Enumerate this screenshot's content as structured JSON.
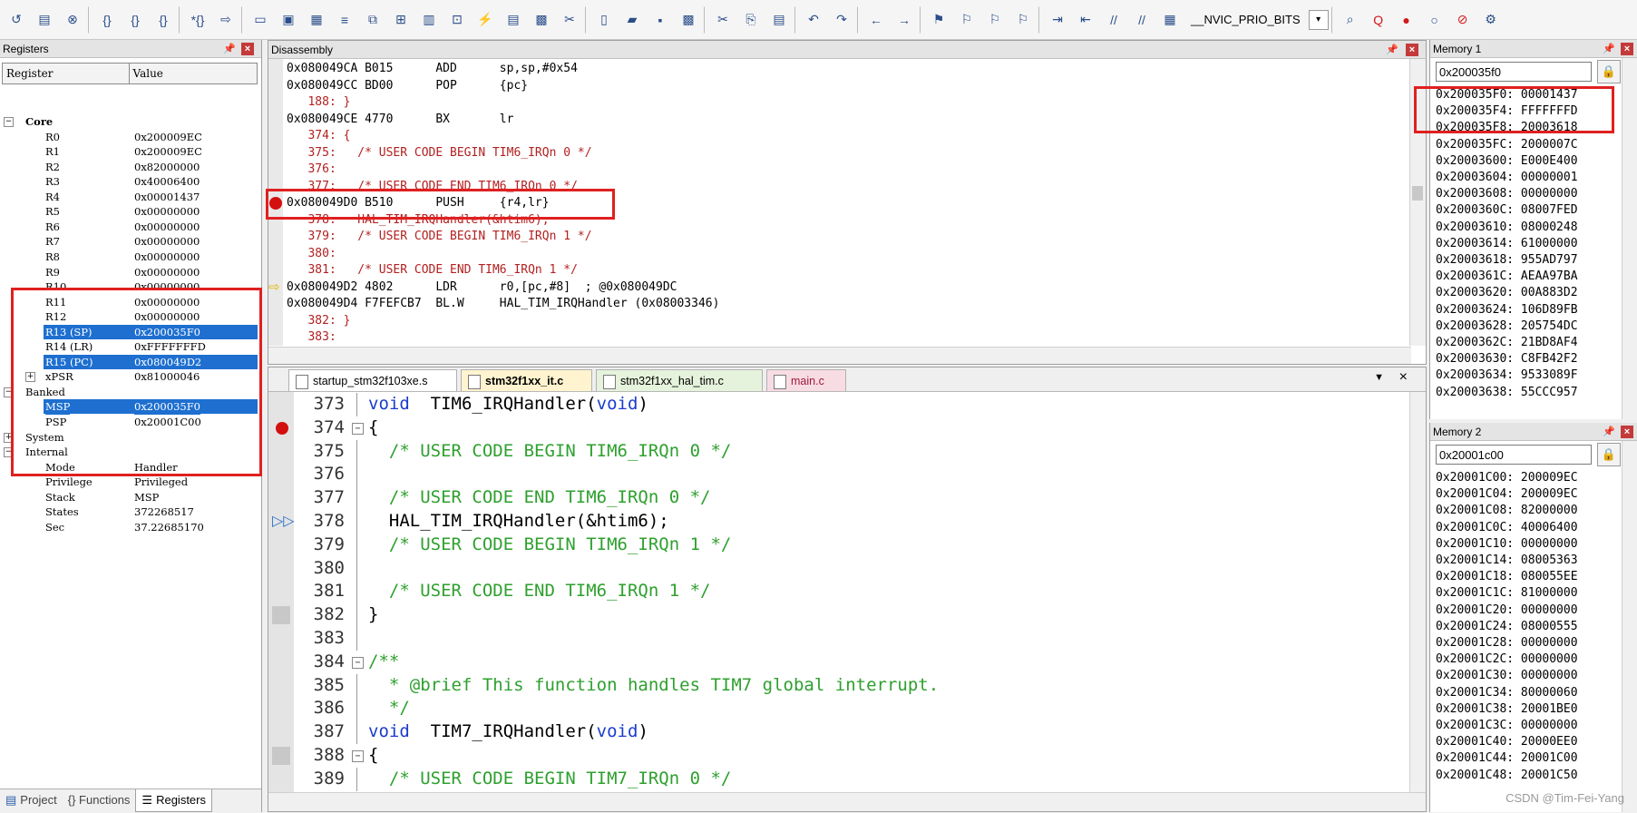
{
  "toolbar": {
    "combo_text": "__NVIC_PRIO_BITS",
    "icons": [
      "reset-icon",
      "run-icon",
      "stop-icon",
      "step-into-icon",
      "step-over-icon",
      "step-out-icon",
      "run-to-cursor-icon",
      "show-next-statement-icon",
      "command-window-icon",
      "disassembly-window-icon",
      "symbols-window-icon",
      "registers-window-icon",
      "call-stack-icon",
      "watch-window-icon",
      "memory-window-icon",
      "serial-window-icon",
      "analysis-window-icon",
      "trace-window-icon",
      "system-viewer-icon",
      "toolbox-icon",
      "new-file-icon",
      "open-file-icon",
      "save-icon",
      "save-all-icon",
      "cut-icon",
      "copy-icon",
      "paste-icon",
      "undo-icon",
      "redo-icon",
      "nav-back-icon",
      "nav-forward-icon",
      "bookmark-icon",
      "bookmark-prev-icon",
      "bookmark-next-icon",
      "bookmark-clear-icon",
      "indent-icon",
      "unindent-icon",
      "comment-icon",
      "uncomment-icon",
      "find-in-files-icon",
      "find-icon",
      "debug-session-icon",
      "insert-breakpoint-icon",
      "enable-breakpoint-icon",
      "kill-breakpoints-icon",
      "options-icon"
    ]
  },
  "registers": {
    "title": "Registers",
    "col_register": "Register",
    "col_value": "Value",
    "rows": [
      {
        "name": "Core",
        "value": "",
        "bold": true
      },
      {
        "name": "R0",
        "value": "0x200009EC"
      },
      {
        "name": "R1",
        "value": "0x200009EC"
      },
      {
        "name": "R2",
        "value": "0x82000000"
      },
      {
        "name": "R3",
        "value": "0x40006400"
      },
      {
        "name": "R4",
        "value": "0x00001437"
      },
      {
        "name": "R5",
        "value": "0x00000000"
      },
      {
        "name": "R6",
        "value": "0x00000000"
      },
      {
        "name": "R7",
        "value": "0x00000000"
      },
      {
        "name": "R8",
        "value": "0x00000000"
      },
      {
        "name": "R9",
        "value": "0x00000000"
      },
      {
        "name": "R10",
        "value": "0x00000000"
      },
      {
        "name": "R11",
        "value": "0x00000000"
      },
      {
        "name": "R12",
        "value": "0x00000000"
      },
      {
        "name": "R13 (SP)",
        "value": "0x200035F0",
        "selected": true
      },
      {
        "name": "R14 (LR)",
        "value": "0xFFFFFFFD"
      },
      {
        "name": "R15 (PC)",
        "value": "0x080049D2",
        "selected": true
      },
      {
        "name": "xPSR",
        "value": "0x81000046"
      },
      {
        "name": "Banked",
        "value": ""
      },
      {
        "name": "MSP",
        "value": "0x200035F0",
        "selected": true
      },
      {
        "name": "PSP",
        "value": "0x20001C00"
      },
      {
        "name": "System",
        "value": ""
      },
      {
        "name": "Internal",
        "value": ""
      },
      {
        "name": "Mode",
        "value": "Handler"
      },
      {
        "name": "Privilege",
        "value": "Privileged"
      },
      {
        "name": "Stack",
        "value": "MSP"
      },
      {
        "name": "States",
        "value": "372268517"
      },
      {
        "name": "Sec",
        "value": "37.22685170"
      }
    ],
    "tabs": [
      "Project",
      "{} Functions",
      "Registers"
    ]
  },
  "disassembly": {
    "title": "Disassembly",
    "lines": [
      {
        "text": "0x080049CA B015      ADD      sp,sp,#0x54",
        "type": "asm"
      },
      {
        "text": "0x080049CC BD00      POP      {pc}",
        "type": "asm"
      },
      {
        "text": "   188: }",
        "type": "src"
      },
      {
        "text": "0x080049CE 4770      BX       lr",
        "type": "asm"
      },
      {
        "text": "   374: {",
        "type": "src"
      },
      {
        "text": "   375:   /* USER CODE BEGIN TIM6_IRQn 0 */",
        "type": "src"
      },
      {
        "text": "   376:",
        "type": "src"
      },
      {
        "text": "   377:   /* USER CODE END TIM6_IRQn 0 */",
        "type": "src"
      },
      {
        "text": "0x080049D0 B510      PUSH     {r4,lr}",
        "type": "asm"
      },
      {
        "text": "   378:   HAL_TIM_IRQHandler(&htim6);",
        "type": "src"
      },
      {
        "text": "   379:   /* USER CODE BEGIN TIM6_IRQn 1 */",
        "type": "src"
      },
      {
        "text": "   380:",
        "type": "src"
      },
      {
        "text": "   381:   /* USER CODE END TIM6_IRQn 1 */",
        "type": "src"
      },
      {
        "text": "0x080049D2 4802      LDR      r0,[pc,#8]  ; @0x080049DC",
        "type": "asm"
      },
      {
        "text": "0x080049D4 F7FEFCB7  BL.W     HAL_TIM_IRQHandler (0x08003346)",
        "type": "asm"
      },
      {
        "text": "   382: }",
        "type": "src"
      },
      {
        "text": "   383:",
        "type": "src"
      }
    ]
  },
  "editor": {
    "tabs": [
      {
        "label": "startup_stm32f103xe.s",
        "active": false
      },
      {
        "label": "stm32f1xx_it.c",
        "active": true
      },
      {
        "label": "stm32f1xx_hal_tim.c",
        "active": false
      },
      {
        "label": "main.c",
        "active": false
      }
    ],
    "lines": [
      {
        "num": "373",
        "fold": "",
        "parts": [
          [
            "kw",
            "void"
          ],
          [
            "",
            "  TIM6_IRQHandler("
          ],
          [
            "kw",
            "void"
          ],
          [
            "",
            ")"
          ]
        ]
      },
      {
        "num": "374",
        "fold": "-",
        "parts": [
          [
            "",
            "{"
          ]
        ]
      },
      {
        "num": "375",
        "fold": "",
        "parts": [
          [
            "cmt",
            "  /* USER CODE BEGIN TIM6_IRQn 0 */"
          ]
        ]
      },
      {
        "num": "376",
        "fold": "",
        "parts": [
          [
            "",
            ""
          ]
        ]
      },
      {
        "num": "377",
        "fold": "",
        "parts": [
          [
            "cmt",
            "  /* USER CODE END TIM6_IRQn 0 */"
          ]
        ]
      },
      {
        "num": "378",
        "fold": "",
        "parts": [
          [
            "",
            "  HAL_TIM_IRQHandler(&htim6);"
          ]
        ]
      },
      {
        "num": "379",
        "fold": "",
        "parts": [
          [
            "cmt",
            "  /* USER CODE BEGIN TIM6_IRQn 1 */"
          ]
        ]
      },
      {
        "num": "380",
        "fold": "",
        "parts": [
          [
            "",
            ""
          ]
        ]
      },
      {
        "num": "381",
        "fold": "",
        "parts": [
          [
            "cmt",
            "  /* USER CODE END TIM6_IRQn 1 */"
          ]
        ]
      },
      {
        "num": "382",
        "fold": "",
        "parts": [
          [
            "",
            "}"
          ]
        ]
      },
      {
        "num": "383",
        "fold": "",
        "parts": [
          [
            "",
            ""
          ]
        ]
      },
      {
        "num": "384",
        "fold": "-",
        "parts": [
          [
            "cmt",
            "/**"
          ]
        ]
      },
      {
        "num": "385",
        "fold": "",
        "parts": [
          [
            "cmt",
            "  * @brief This function handles TIM7 global interrupt."
          ]
        ]
      },
      {
        "num": "386",
        "fold": "",
        "parts": [
          [
            "cmt",
            "  */"
          ]
        ]
      },
      {
        "num": "387",
        "fold": "",
        "parts": [
          [
            "kw",
            "void"
          ],
          [
            "",
            "  TIM7_IRQHandler("
          ],
          [
            "kw",
            "void"
          ],
          [
            "",
            ")"
          ]
        ]
      },
      {
        "num": "388",
        "fold": "-",
        "parts": [
          [
            "",
            "{"
          ]
        ]
      },
      {
        "num": "389",
        "fold": "",
        "parts": [
          [
            "cmt",
            "  /* USER CODE BEGIN TIM7_IRQn 0 */"
          ]
        ]
      }
    ]
  },
  "memory1": {
    "title": "Memory 1",
    "address": "0x200035f0",
    "lines": [
      "0x200035F0: 00001437",
      "0x200035F4: FFFFFFFD",
      "0x200035F8: 20003618",
      "0x200035FC: 2000007C",
      "0x20003600: E000E400",
      "0x20003604: 00000001",
      "0x20003608: 00000000",
      "0x2000360C: 08007FED",
      "0x20003610: 08000248",
      "0x20003614: 61000000",
      "0x20003618: 955AD797",
      "0x2000361C: AEAA97BA",
      "0x20003620: 00A883D2",
      "0x20003624: 106D89FB",
      "0x20003628: 205754DC",
      "0x2000362C: 21BD8AF4",
      "0x20003630: C8FB42F2",
      "0x20003634: 9533089F",
      "0x20003638: 55CCC957"
    ]
  },
  "memory2": {
    "title": "Memory 2",
    "address": "0x20001c00",
    "lines": [
      "0x20001C00: 200009EC",
      "0x20001C04: 200009EC",
      "0x20001C08: 82000000",
      "0x20001C0C: 40006400",
      "0x20001C10: 00000000",
      "0x20001C14: 08005363",
      "0x20001C18: 080055EE",
      "0x20001C1C: 81000000",
      "0x20001C20: 00000000",
      "0x20001C24: 08000555",
      "0x20001C28: 00000000",
      "0x20001C2C: 00000000",
      "0x20001C30: 00000000",
      "0x20001C34: 80000060",
      "0x20001C38: 20001BE0",
      "0x20001C3C: 00000000",
      "0x20001C40: 20000EE0",
      "0x20001C44: 20001C00",
      "0x20001C48: 20001C50"
    ]
  },
  "watermark": "CSDN @Tim-Fei-Yang"
}
